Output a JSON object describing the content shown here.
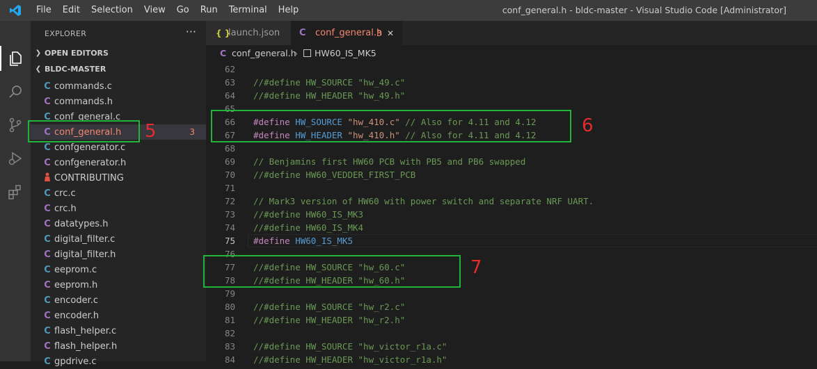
{
  "window": {
    "title": "conf_general.h - bldc-master - Visual Studio Code [Administrator]",
    "menu": [
      "File",
      "Edit",
      "Selection",
      "View",
      "Go",
      "Run",
      "Terminal",
      "Help"
    ]
  },
  "colors": {
    "accent_blue": "#007acc",
    "annotation_green": "#22b43a",
    "annotation_red": "#e52b2b",
    "c_file_icon": "#519aba",
    "modified_orange": "#f48771"
  },
  "activity_bar": [
    "files-icon",
    "search-icon",
    "source-control-icon",
    "run-debug-icon",
    "extensions-icon"
  ],
  "sidebar": {
    "title": "EXPLORER",
    "more": "···",
    "sections": {
      "open_editors": "OPEN EDITORS",
      "project": "BLDC-MASTER"
    },
    "files": [
      {
        "name": "commands.c",
        "icon": "C"
      },
      {
        "name": "commands.h",
        "icon": "C"
      },
      {
        "name": "conf_general.c",
        "icon": "C"
      },
      {
        "name": "conf_general.h",
        "icon": "C",
        "badge": "3",
        "selected": true
      },
      {
        "name": "confgenerator.c",
        "icon": "C"
      },
      {
        "name": "confgenerator.h",
        "icon": "C"
      },
      {
        "name": "CONTRIBUTING",
        "icon": "person"
      },
      {
        "name": "crc.c",
        "icon": "C"
      },
      {
        "name": "crc.h",
        "icon": "C"
      },
      {
        "name": "datatypes.h",
        "icon": "C"
      },
      {
        "name": "digital_filter.c",
        "icon": "C"
      },
      {
        "name": "digital_filter.h",
        "icon": "C"
      },
      {
        "name": "eeprom.c",
        "icon": "C"
      },
      {
        "name": "eeprom.h",
        "icon": "C"
      },
      {
        "name": "encoder.c",
        "icon": "C"
      },
      {
        "name": "encoder.h",
        "icon": "C"
      },
      {
        "name": "flash_helper.c",
        "icon": "C"
      },
      {
        "name": "flash_helper.h",
        "icon": "C"
      },
      {
        "name": "gpdrive.c",
        "icon": "C"
      }
    ]
  },
  "tabs": [
    {
      "label": "launch.json",
      "icon": "{ }"
    },
    {
      "label": "conf_general.h",
      "icon": "C",
      "badge": "3",
      "close": "✕"
    }
  ],
  "breadcrumb": {
    "file": "conf_general.h",
    "separator": "›",
    "symbol": "HW60_IS_MK5"
  },
  "code": {
    "current_line": "75",
    "lines": [
      {
        "no": "62",
        "tokens": []
      },
      {
        "no": "63",
        "tokens": [
          {
            "t": "c",
            "v": "//#define HW_SOURCE \"hw_49.c\""
          }
        ]
      },
      {
        "no": "64",
        "tokens": [
          {
            "t": "c",
            "v": "//#define HW_HEADER \"hw_49.h\""
          }
        ]
      },
      {
        "no": "65",
        "tokens": []
      },
      {
        "no": "66",
        "tokens": [
          {
            "t": "k",
            "v": "#define"
          },
          {
            "t": "p",
            "v": " "
          },
          {
            "t": "m",
            "v": "HW_SOURCE"
          },
          {
            "t": "p",
            "v": " "
          },
          {
            "t": "s",
            "v": "\"hw_410.c\""
          },
          {
            "t": "c",
            "v": " // Also for 4.11 and 4.12"
          }
        ]
      },
      {
        "no": "67",
        "tokens": [
          {
            "t": "k",
            "v": "#define"
          },
          {
            "t": "p",
            "v": " "
          },
          {
            "t": "m",
            "v": "HW_HEADER"
          },
          {
            "t": "p",
            "v": " "
          },
          {
            "t": "s",
            "v": "\"hw_410.h\""
          },
          {
            "t": "c",
            "v": " // Also for 4.11 and 4.12"
          }
        ]
      },
      {
        "no": "68",
        "tokens": []
      },
      {
        "no": "69",
        "tokens": [
          {
            "t": "c",
            "v": "// Benjamins first HW60 PCB with PB5 and PB6 swapped"
          }
        ]
      },
      {
        "no": "70",
        "tokens": [
          {
            "t": "c",
            "v": "//#define HW60_VEDDER_FIRST_PCB"
          }
        ]
      },
      {
        "no": "71",
        "tokens": []
      },
      {
        "no": "72",
        "tokens": [
          {
            "t": "c",
            "v": "// Mark3 version of HW60 with power switch and separate NRF UART."
          }
        ]
      },
      {
        "no": "73",
        "tokens": [
          {
            "t": "c",
            "v": "//#define HW60_IS_MK3"
          }
        ]
      },
      {
        "no": "74",
        "tokens": [
          {
            "t": "c",
            "v": "//#define HW60_IS_MK4"
          }
        ]
      },
      {
        "no": "75",
        "tokens": [
          {
            "t": "k",
            "v": "#define"
          },
          {
            "t": "p",
            "v": " "
          },
          {
            "t": "m",
            "v": "HW60_IS_MK5"
          }
        ]
      },
      {
        "no": "76",
        "tokens": []
      },
      {
        "no": "77",
        "tokens": [
          {
            "t": "c",
            "v": "//#define HW_SOURCE \"hw_60.c\""
          }
        ]
      },
      {
        "no": "78",
        "tokens": [
          {
            "t": "c",
            "v": "//#define HW_HEADER \"hw_60.h\""
          }
        ]
      },
      {
        "no": "79",
        "tokens": []
      },
      {
        "no": "80",
        "tokens": [
          {
            "t": "c",
            "v": "//#define HW_SOURCE \"hw_r2.c\""
          }
        ]
      },
      {
        "no": "81",
        "tokens": [
          {
            "t": "c",
            "v": "//#define HW_HEADER \"hw_r2.h\""
          }
        ]
      },
      {
        "no": "82",
        "tokens": []
      },
      {
        "no": "83",
        "tokens": [
          {
            "t": "c",
            "v": "//#define HW_SOURCE \"hw_victor_r1a.c\""
          }
        ]
      },
      {
        "no": "84",
        "tokens": [
          {
            "t": "c",
            "v": "//#define HW_HEADER \"hw_victor_r1a.h\""
          }
        ]
      }
    ]
  },
  "annotations": [
    {
      "label": "5"
    },
    {
      "label": "6"
    },
    {
      "label": "7"
    }
  ]
}
